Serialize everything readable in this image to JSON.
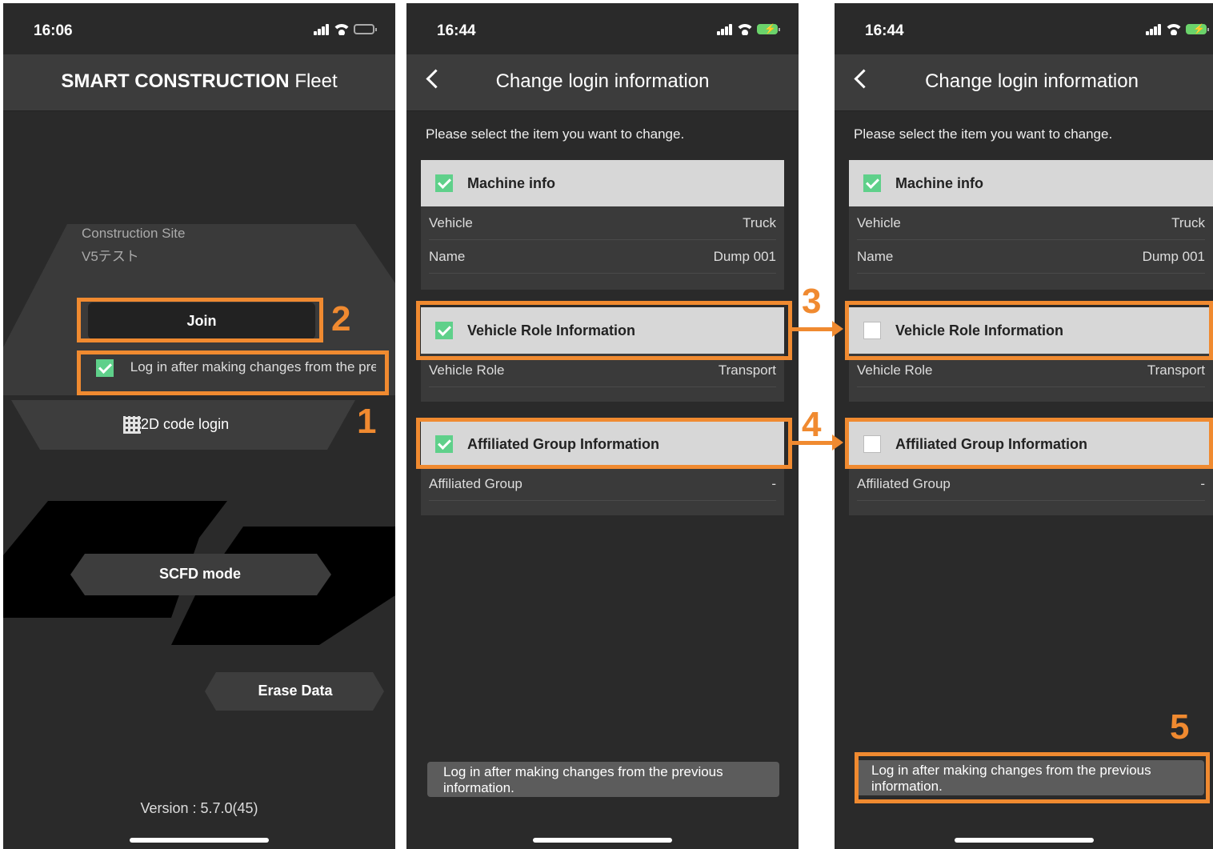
{
  "screen1": {
    "time": "16:06",
    "title_bold": "SMART CONSTRUCTION",
    "title_rest": "Fleet",
    "site_label": "Construction Site",
    "site_name": "V5テスト",
    "join_label": "Join",
    "login_after_label": "Log in after making changes from the previous information.",
    "qr_login_label": "2D code login",
    "scfd_label": "SCFD mode",
    "erase_label": "Erase Data",
    "version": "Version : 5.7.0(45)"
  },
  "screen2": {
    "time": "16:44",
    "title": "Change login information",
    "instruction": "Please select the item you want to change.",
    "machine_head": "Machine info",
    "vehicle_label": "Vehicle",
    "vehicle_value": "Truck",
    "name_label": "Name",
    "name_value": "Dump 001",
    "role_head": "Vehicle Role Information",
    "role_label": "Vehicle Role",
    "role_value": "Transport",
    "group_head": "Affiliated Group Information",
    "group_label": "Affiliated Group",
    "group_value": "-",
    "bottom_btn": "Log in after making changes from the previous information."
  },
  "screen3": {
    "time": "16:44",
    "title": "Change login information",
    "instruction": "Please select the item you want to change.",
    "machine_head": "Machine info",
    "vehicle_label": "Vehicle",
    "vehicle_value": "Truck",
    "name_label": "Name",
    "name_value": "Dump 001",
    "role_head": "Vehicle Role Information",
    "role_label": "Vehicle Role",
    "role_value": "Transport",
    "group_head": "Affiliated Group Information",
    "group_label": "Affiliated Group",
    "group_value": "-",
    "bottom_btn": "Log in after making changes from the previous information."
  },
  "annotations": [
    "1",
    "2",
    "3",
    "4",
    "5"
  ],
  "colors": {
    "annotation": "#f08a30",
    "check": "#5fd08a",
    "panel_bg": "#2a2a2a"
  }
}
